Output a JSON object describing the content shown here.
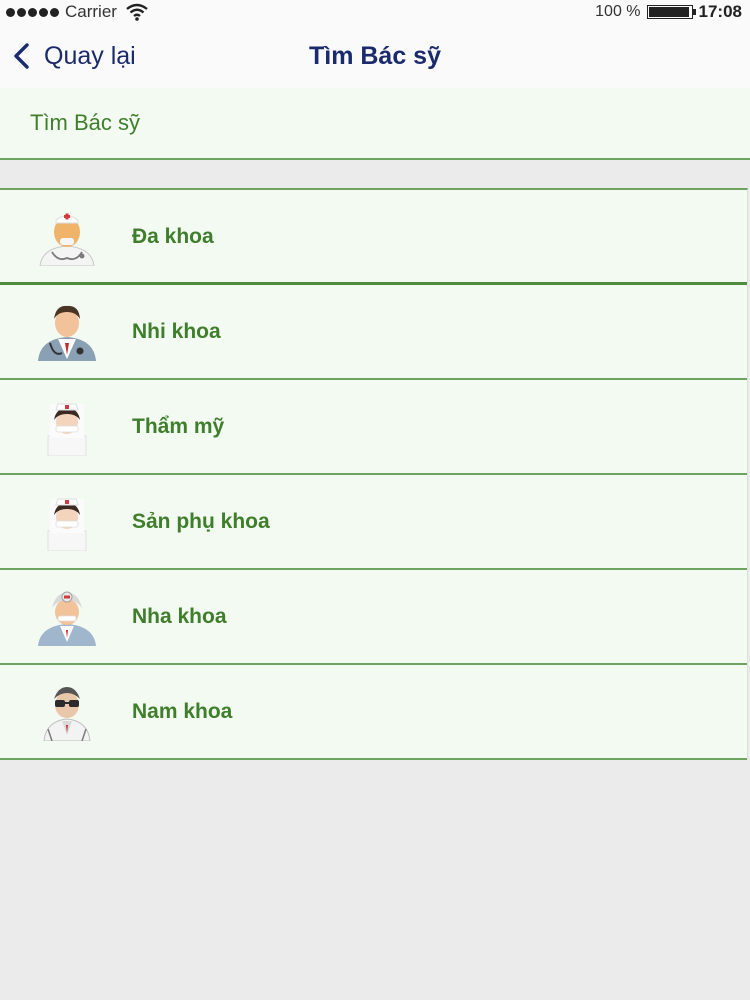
{
  "status_bar": {
    "carrier": "Carrier",
    "battery": "100 %",
    "time": "17:08"
  },
  "nav": {
    "back_label": "Quay lại",
    "title": "Tìm Bác sỹ"
  },
  "section_header": {
    "label": "Tìm Bác sỹ"
  },
  "specialties": [
    {
      "label": "Đa khoa",
      "icon": "doctor-elder-icon"
    },
    {
      "label": "Nhi khoa",
      "icon": "doctor-stethoscope-icon"
    },
    {
      "label": "Thẩm mỹ",
      "icon": "nurse-icon"
    },
    {
      "label": "Sản phụ khoa",
      "icon": "nurse-icon"
    },
    {
      "label": "Nha khoa",
      "icon": "doctor-head-mirror-icon"
    },
    {
      "label": "Nam khoa",
      "icon": "doctor-glasses-icon"
    }
  ],
  "colors": {
    "accent_green": "#3f7e2b",
    "divider_green": "#6ea25f",
    "row_background": "#f2faf1",
    "nav_text": "#1a2a6c",
    "page_background": "#ebebeb"
  }
}
